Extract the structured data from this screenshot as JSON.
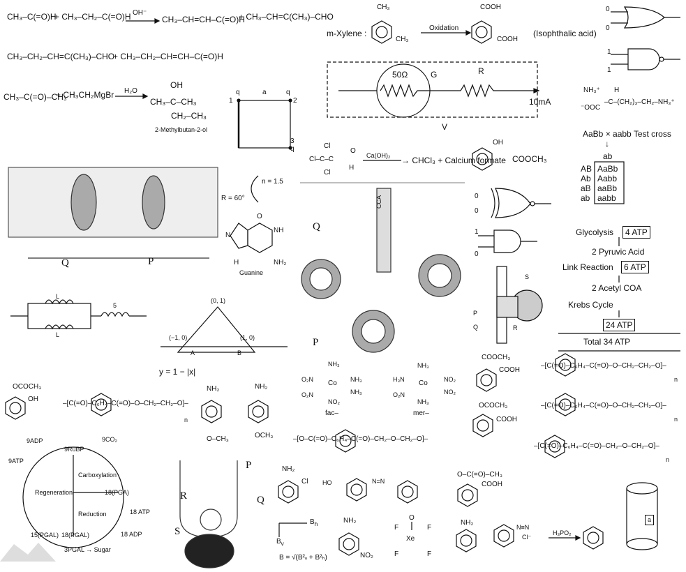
{
  "aldol": {
    "r1": "CH₃–C(=O)H",
    "r2": "+ CH₃–CH₂–C(=O)H",
    "cond": "OH⁻",
    "p1": "CH₃–CH=CH–C(=O)H",
    "p2": "+ CH₃–CH=C(CH₃)–CHO",
    "p3": "CH₃–CH₂–CH=C(CH₃)–CHO",
    "p4": "+ CH₃–CH₂–CH=CH–C(=O)H"
  },
  "grignard": {
    "r1": "CH₃–C(=O)–CH₃",
    "r2": "+ CH₃CH₂MgBr",
    "cond": "H₂O",
    "oh": "OH",
    "p1": "CH₃–C–CH₃",
    "p2": "CH₂–CH₃",
    "name": "2-Methylbutan-2-ol"
  },
  "square": {
    "q": "q",
    "a": "a",
    "n1": "1",
    "n2": "2",
    "n3": "3"
  },
  "xylene": {
    "label": "m-Xylene :",
    "me": "CH₃",
    "cond": "Oxidation",
    "cooh": "COOH",
    "name": "(Isophthalic acid)"
  },
  "circuit": {
    "r1": "50Ω",
    "g": "G",
    "r": "R",
    "current": "10mA",
    "v": "V"
  },
  "gates": {
    "zero": "0",
    "one": "1"
  },
  "lysine": {
    "nh3": "NH₃⁺",
    "h": "H",
    "chain": "–C–(CH₂)₃–CH₂–NH₃⁺",
    "ooc": "⁻OOC"
  },
  "genetics": {
    "title": "AaBb × aabb Test cross",
    "arrow": "↓",
    "gamete": "ab",
    "rows": [
      [
        "AB",
        "AaBb"
      ],
      [
        "Ab",
        "Aabb"
      ],
      [
        "aB",
        "aaBb"
      ],
      [
        "ab",
        "aabb"
      ]
    ]
  },
  "haloform": {
    "cl": "Cl",
    "mid": "Cl–C–C",
    "o": "O",
    "h": "H",
    "cond": "Ca(OH)₂",
    "product": "→ CHCl₃ + Calcium formate"
  },
  "salicylate": {
    "oh": "OH",
    "ester": "COOCH₃"
  },
  "membrane": {
    "q": "Q",
    "p": "P"
  },
  "lens": {
    "n": "n = 1.5",
    "r": "R = 60°"
  },
  "guanine": {
    "name": "Guanine",
    "o": "O",
    "nh": "NH",
    "nh2": "NH₂",
    "n": "N",
    "h": "H"
  },
  "inductors": {
    "l": "L",
    "five": "5"
  },
  "graph": {
    "top": "(0, 1)",
    "left": "(−1, 0)",
    "right": "(1, 0)",
    "a": "A",
    "b": "B",
    "eq": "y = 1 − |x|"
  },
  "trna": {
    "q": "Q",
    "p": "P",
    "cca": "CCA"
  },
  "respiration": {
    "glycolysis": "Glycolysis",
    "atp1": "4 ATP",
    "pyruvic": "2 Pyruvic Acid",
    "link": "Link Reaction",
    "atp2": "6 ATP",
    "acetyl": "2 Acetyl COA",
    "krebs": "Krebs Cycle",
    "atp3": "24 ATP",
    "total": "Total 34 ATP"
  },
  "cell": {
    "s": "S",
    "p": "P",
    "q": "Q",
    "r": "R"
  },
  "complexes": {
    "nh3": "NH₃",
    "no2": "NO₂",
    "o2n": "O₂N",
    "h3n": "H₃N",
    "co": "Co",
    "fac": "fac–",
    "mer": "mer–"
  },
  "polymers": {
    "p1": "–[C(=O)–C₆H₄–C(=O)–O–CH₂–CH₂–O]–",
    "p2": "–[C(=O)–C₆H₄–C(=O)–O–CH₂–CH₂–O]–",
    "p3": "–[C(=O)–C₆H₄–C(=O)–CH₂–O–CH₂–O]–",
    "p4": "–[O–C(=O)–C₆H₄–C(=O)–CH₂–O–CH₂–O]–",
    "p5": "–[C(=O)–C₆H₄–C(=O)–O–CH₂–CH₂–O]–",
    "n": "n"
  },
  "small": {
    "ococh3": "OCOCH₃",
    "oh": "OH",
    "nh2": "NH₂",
    "och3": "O–CH₃",
    "och3b": "OCH₃",
    "cooch3": "COOCH₃",
    "cooh": "COOH",
    "ester2": "O–C(=O)–CH₃",
    "cl": "Cl",
    "ho": "HO",
    "azo": "N=N",
    "no2": "NO₂"
  },
  "calvin": {
    "adp": "9ADP",
    "atp": "9ATP",
    "rubp": "9RuBP",
    "co2": "9CO₂",
    "carb": "Carboxylation",
    "regen": "Regeneration",
    "pga": "18(PGA)",
    "red": "Reduction",
    "atp18": "18 ATP",
    "adp18": "18 ADP",
    "pgal15": "15(PGAL)",
    "pgal18": "18(PGAL)",
    "sugar": "3PGAL → Sugar"
  },
  "magnet": {
    "bh": "B",
    "bhs": "h",
    "bv": "B",
    "bvs": "v",
    "eq": "B = √(B²ᵥ + B²ₕ)"
  },
  "xenon": {
    "f": "F",
    "o": "O",
    "xe": "Xe"
  },
  "diazo": {
    "n2": "N≡N",
    "cl": "Cl⁻",
    "cond": "H₃PO₂"
  },
  "cylinder": {
    "a": "a"
  }
}
